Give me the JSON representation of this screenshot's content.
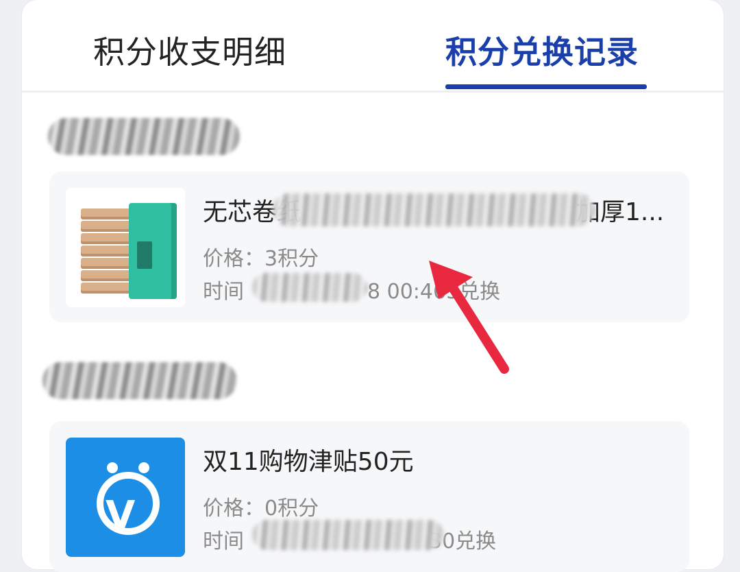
{
  "tabs": {
    "income_expense": "积分收支明细",
    "redeem_records": "积分兑换记录"
  },
  "records": [
    {
      "title": "无芯卷纸",
      "title_tail": "加厚1...",
      "price_label": "价格：",
      "price_value": "3积分",
      "time_label": "时间",
      "time_tail": "8 00:46",
      "time_suffix": "5兑换",
      "icon": "toilet-paper-product-icon"
    },
    {
      "title": "双11购物津贴50元",
      "price_label": "价格：",
      "price_value": "0积分",
      "time_label": "时间",
      "time_tail": "30兑换",
      "icon": "shopping-app-icon"
    }
  ],
  "colors": {
    "accent": "#1b3faa",
    "arrow": "#e8283e",
    "app_blue": "#1d8ee6"
  }
}
